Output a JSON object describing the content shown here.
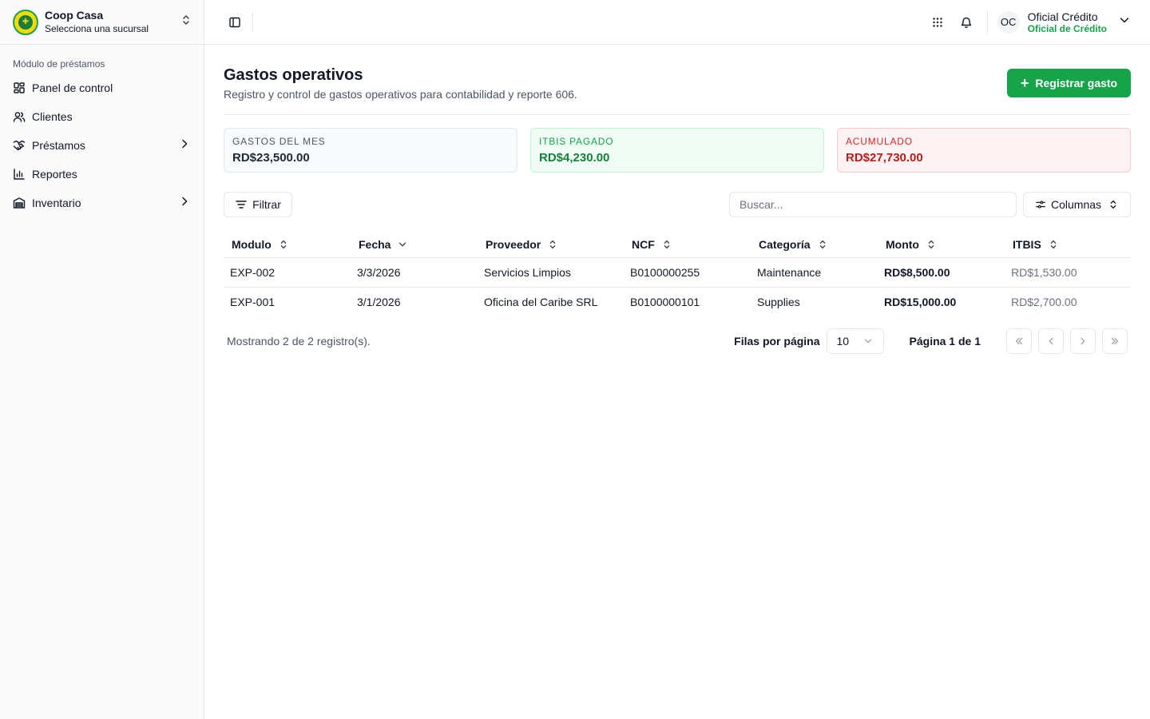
{
  "brand": {
    "title": "Coop Casa",
    "subtitle": "Selecciona una sucursal"
  },
  "sidebar": {
    "section_label": "Módulo de préstamos",
    "items": [
      {
        "label": "Panel de control",
        "icon": "dashboard-icon"
      },
      {
        "label": "Clientes",
        "icon": "users-icon"
      },
      {
        "label": "Préstamos",
        "icon": "handshake-icon",
        "has_children": true
      },
      {
        "label": "Reportes",
        "icon": "bar-chart-icon"
      },
      {
        "label": "Inventario",
        "icon": "inventory-icon",
        "has_children": true
      }
    ]
  },
  "user": {
    "initials": "OC",
    "name": "Oficial Crédito",
    "role": "Oficial de Crédito"
  },
  "page": {
    "title": "Gastos operativos",
    "subtitle": "Registro y control de gastos operativos para contabilidad y reporte 606.",
    "primary_action": "Registrar gasto"
  },
  "stats": [
    {
      "label": "GASTOS DEL MES",
      "value": "RD$23,500.00",
      "tone": "neutral"
    },
    {
      "label": "ITBIS PAGADO",
      "value": "RD$4,230.00",
      "tone": "green"
    },
    {
      "label": "ACUMULADO",
      "value": "RD$27,730.00",
      "tone": "red"
    }
  ],
  "toolbar": {
    "filter_label": "Filtrar",
    "search_placeholder": "Buscar...",
    "columns_label": "Columnas"
  },
  "table": {
    "columns": [
      "Modulo",
      "Fecha",
      "Proveedor",
      "NCF",
      "Categoría",
      "Monto",
      "ITBIS"
    ],
    "rows": [
      [
        "EXP-002",
        "3/3/2026",
        "Servicios Limpios",
        "B0100000255",
        "Maintenance",
        "RD$8,500.00",
        "RD$1,530.00"
      ],
      [
        "EXP-001",
        "3/1/2026",
        "Oficina del Caribe SRL",
        "B0100000101",
        "Supplies",
        "RD$15,000.00",
        "RD$2,700.00"
      ]
    ]
  },
  "pagination": {
    "summary": "Mostrando 2 de 2 registro(s).",
    "rows_per_page_label": "Filas por página",
    "rows_per_page_value": "10",
    "page_label": "Página 1 de 1"
  },
  "colors": {
    "accent": "#16a34a",
    "danger": "#b91c1c"
  }
}
